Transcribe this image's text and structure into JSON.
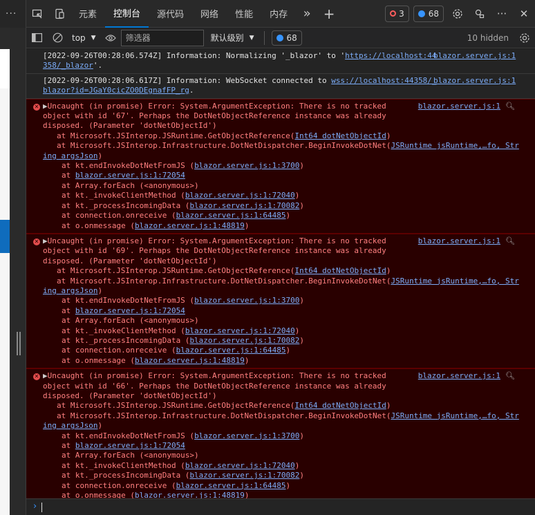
{
  "left": {
    "more": "···"
  },
  "tabs": [
    {
      "label": "元素",
      "active": false
    },
    {
      "label": "控制台",
      "active": true
    },
    {
      "label": "源代码",
      "active": false
    },
    {
      "label": "网络",
      "active": false
    },
    {
      "label": "性能",
      "active": false
    },
    {
      "label": "内存",
      "active": false
    }
  ],
  "tabbar": {
    "more_tabs": "»",
    "add_tab": "+",
    "errors_count": "3",
    "issues_count": "68",
    "more": "···",
    "close": "✕"
  },
  "toolbar": {
    "context": "top",
    "filter_placeholder": "筛选器",
    "levels": "默认级别",
    "issues_count": "68",
    "hidden": "10 hidden"
  },
  "messages": [
    {
      "type": "info",
      "text_a": "[2022-09-26T00:28:06.574Z] Information: Normalizing '_blazor' to '",
      "link": "https://localhost:44358/_blazor",
      "text_b": "'.",
      "source": "blazor.server.js:1"
    },
    {
      "type": "info",
      "text_a": "[2022-09-26T00:28:06.617Z] Information: WebSocket connected to ",
      "link": "wss://localhost:44358/_blazor?id=JGaY0cicZO0DEgnafFP_rg",
      "text_b": ".",
      "source": "blazor.server.js:1"
    }
  ],
  "errors": [
    {
      "l1": "Uncaught (in promise) Error: System.ArgumentException: There is no tracked",
      "l2": "object with id '67'. Perhaps the DotNetObjectReference instance was already",
      "l3": "disposed. (Parameter 'dotNetObjectId')",
      "source": "blazor.server.js:1"
    },
    {
      "l1": "Uncaught (in promise) Error: System.ArgumentException: There is no tracked",
      "l2": "object with id '69'. Perhaps the DotNetObjectReference instance was already",
      "l3": "disposed. (Parameter 'dotNetObjectId')",
      "source": "blazor.server.js:1"
    },
    {
      "l1": "Uncaught (in promise) Error: System.ArgumentException: There is no tracked",
      "l2": "object with id '66'. Perhaps the DotNetObjectReference instance was already",
      "l3": "disposed. (Parameter 'dotNetObjectId')",
      "source": "blazor.server.js:1"
    }
  ],
  "stack": {
    "s1a": "at Microsoft.JSInterop.JSRuntime.GetObjectReference(",
    "s1link": "Int64 dotNetObjectId",
    "s1b": ")",
    "s2a": "at Microsoft.JSInterop.Infrastructure.DotNetDispatcher.BeginInvokeDotNet(",
    "s2link1": "JSRuntime jsRuntime,…fo, Str",
    "s2link2": "ing argsJson",
    "s2b": ")",
    "f1a": "at kt.endInvokeDotNetFromJS (",
    "f1link": "blazor.server.js:1:3700",
    "f1b": ")",
    "f2a": "at ",
    "f2link": "blazor.server.js:1:72054",
    "f3": "at Array.forEach (<anonymous>)",
    "f4a": "at kt._invokeClientMethod (",
    "f4link": "blazor.server.js:1:72040",
    "f4b": ")",
    "f5a": "at kt._processIncomingData (",
    "f5link": "blazor.server.js:1:70082",
    "f5b": ")",
    "f6a": "at connection.onreceive (",
    "f6link": "blazor.server.js:1:64485",
    "f6b": ")",
    "f7a": "at o.onmessage (",
    "f7link": "blazor.server.js:1:48819",
    "f7b": ")"
  },
  "prompt": {
    "arrow": "›"
  },
  "colors": {
    "accent": "#0078d4",
    "error_bg": "#290000",
    "error_text": "#ff8080",
    "link": "#7cacf8"
  }
}
